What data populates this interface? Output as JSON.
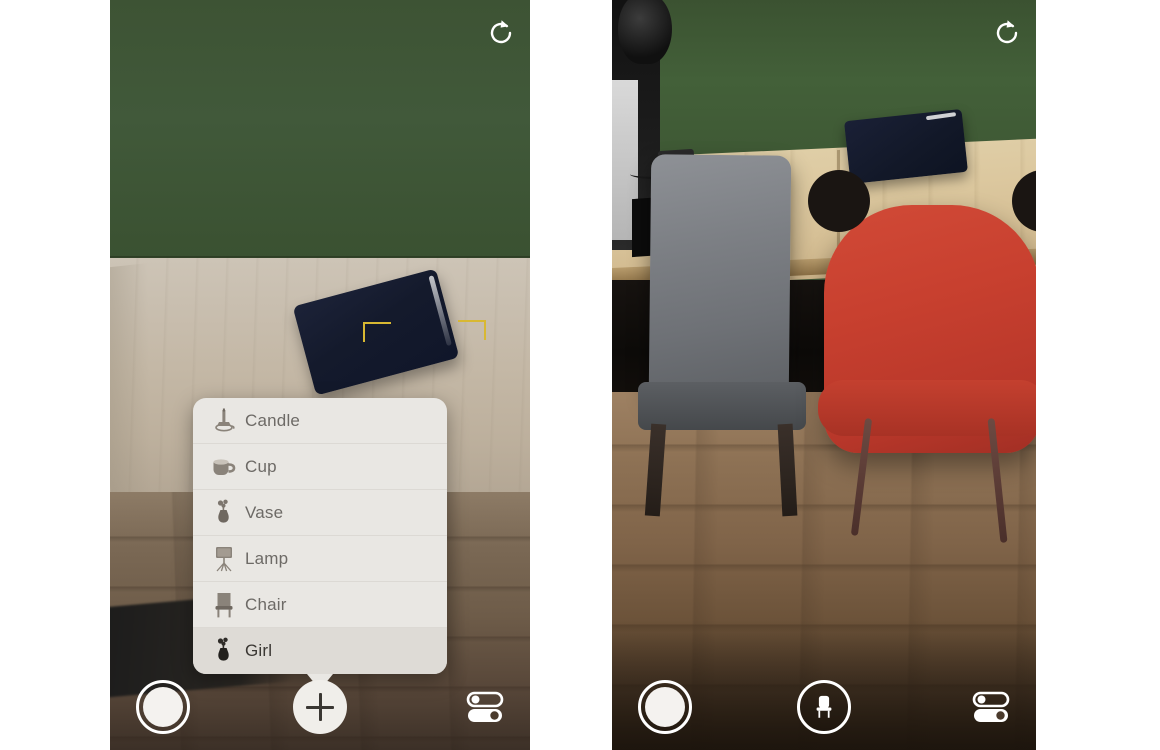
{
  "app": {
    "type": "ar-camera-app",
    "panel_count": 2
  },
  "colors": {
    "wall_green": "#3f5636",
    "menu_background": "#e9e7e3",
    "menu_selected": "#dedbd6",
    "menu_label": "#6d6a66",
    "menu_label_selected": "#3a3733",
    "ar_bracket_yellow": "#d8b832",
    "red_chair": "#c8402f",
    "grey_chair": "#7d8085",
    "shutter_white": "#ffffff",
    "add_button_fill": "#f0eeea"
  },
  "left_panel": {
    "name": "object-picker-screen",
    "refresh_icon": "refresh-icon",
    "ar_focus_brackets": {
      "name": "ar-focus-brackets",
      "color": "#d8b832",
      "corners": [
        "top-left",
        "top-right"
      ]
    },
    "scene": {
      "wall": "green-wall",
      "surface": "light-wood-desk",
      "tracked_object": "navy-tablet",
      "floor": "wood-plank-floor"
    },
    "menu": {
      "name": "object-menu",
      "items": [
        {
          "label": "Candle",
          "icon": "candle-icon",
          "selected": false
        },
        {
          "label": "Cup",
          "icon": "cup-icon",
          "selected": false
        },
        {
          "label": "Vase",
          "icon": "vase-icon",
          "selected": false
        },
        {
          "label": "Lamp",
          "icon": "lamp-icon",
          "selected": false
        },
        {
          "label": "Chair",
          "icon": "chair-icon",
          "selected": false
        },
        {
          "label": "Girl",
          "icon": "vase-icon",
          "selected": true
        }
      ]
    },
    "toolbar": {
      "shutter_label": "shutter-button",
      "add_label": "add-object-button",
      "add_icon": "plus-icon",
      "settings_label": "settings-button",
      "settings_icon": "sliders-toggle-icon"
    }
  },
  "right_panel": {
    "name": "ar-placement-screen",
    "refresh_icon": "refresh-icon",
    "scene": {
      "wall": "green-wall",
      "surface": "light-wood-desk",
      "objects": [
        "grey-chair",
        "red-chair-ar-placed",
        "navy-tablet",
        "monitor",
        "headset"
      ],
      "floor": "wood-plank-floor"
    },
    "toolbar": {
      "shutter_label": "shutter-button",
      "place_label": "place-chair-button",
      "place_icon": "chair-icon",
      "settings_label": "settings-button",
      "settings_icon": "sliders-toggle-icon"
    }
  }
}
